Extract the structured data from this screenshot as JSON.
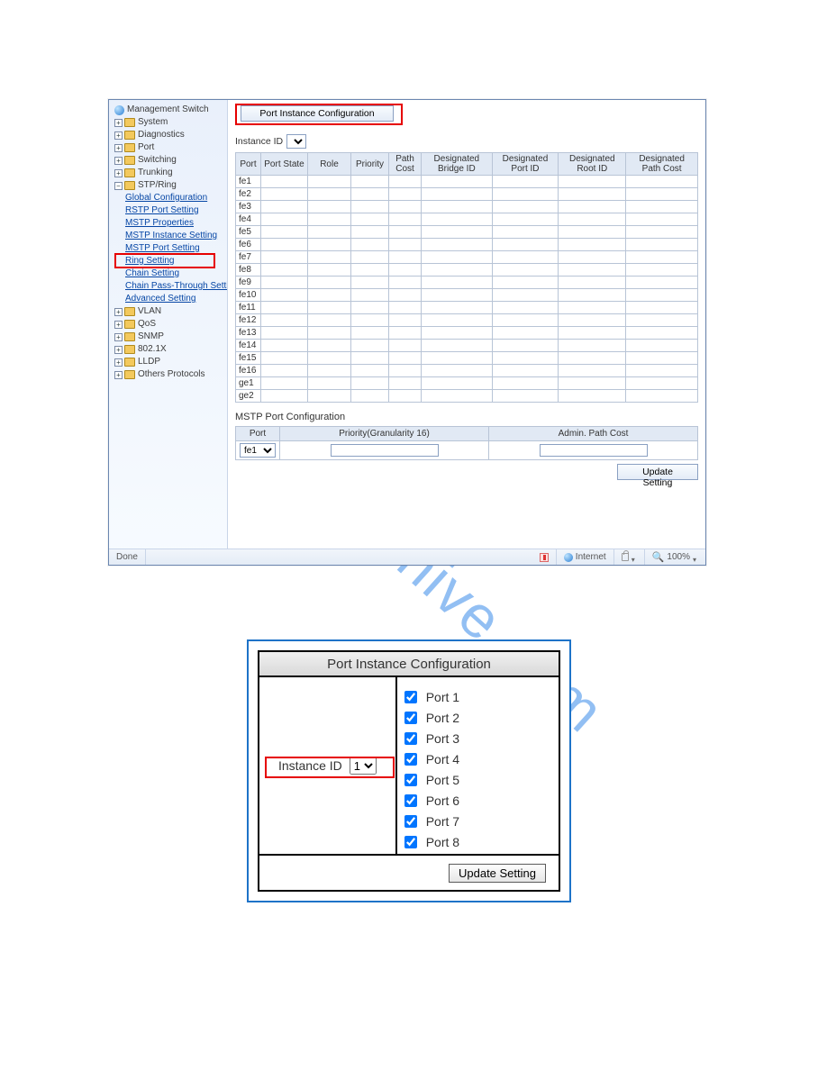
{
  "watermark": "manualshive.com",
  "shot1": {
    "sidebar": {
      "root_label": "Management Switch",
      "folders": [
        "System",
        "Diagnostics",
        "Port",
        "Switching",
        "Trunking"
      ],
      "stp_label": "STP/Ring",
      "stp_items": [
        "Global Configuration",
        "RSTP Port Setting",
        "MSTP Properties",
        "MSTP Instance Setting",
        "MSTP Port Setting",
        "Ring Setting",
        "Chain Setting",
        "Chain Pass-Through Setting",
        "Advanced Setting"
      ],
      "folders2": [
        "VLAN",
        "QoS",
        "SNMP",
        "802.1X",
        "LLDP",
        "Others Protocols"
      ]
    },
    "buttons": {
      "port_instance": "Port Instance Configuration",
      "update": "Update Setting"
    },
    "instance_label": "Instance ID",
    "table_headers": [
      "Port",
      "Port State",
      "Role",
      "Priority",
      "Path Cost",
      "Designated Bridge ID",
      "Designated Port ID",
      "Designated Root ID",
      "Designated Path Cost"
    ],
    "ports": [
      "fe1",
      "fe2",
      "fe3",
      "fe4",
      "fe5",
      "fe6",
      "fe7",
      "fe8",
      "fe9",
      "fe10",
      "fe11",
      "fe12",
      "fe13",
      "fe14",
      "fe15",
      "fe16",
      "ge1",
      "ge2"
    ],
    "sub_title": "MSTP Port Configuration",
    "conf_headers": [
      "Port",
      "Priority(Granularity 16)",
      "Admin. Path Cost"
    ],
    "conf_port_value": "fe1",
    "status": {
      "done": "Done",
      "internet": "Internet",
      "zoom": "100%"
    }
  },
  "shot2": {
    "title": "Port Instance Configuration",
    "instance_label": "Instance ID",
    "instance_value": "1",
    "port_prefix": "Port",
    "update": "Update Setting",
    "ports": [
      "1",
      "2",
      "3",
      "4",
      "5",
      "6",
      "7",
      "8"
    ]
  }
}
